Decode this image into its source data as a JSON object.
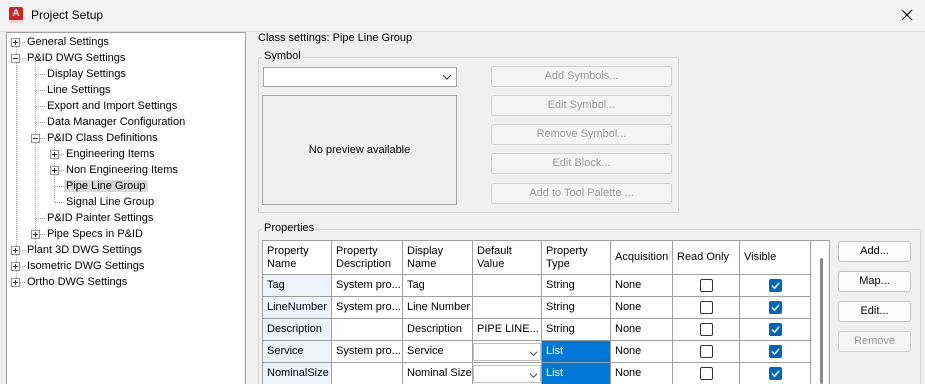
{
  "window": {
    "title": "Project Setup",
    "app_icon_letter": "A"
  },
  "tree": {
    "items": [
      {
        "label": "General Settings"
      },
      {
        "label": "P&ID DWG Settings"
      },
      {
        "label": "Display Settings"
      },
      {
        "label": "Line Settings"
      },
      {
        "label": "Export and Import Settings"
      },
      {
        "label": "Data Manager Configuration"
      },
      {
        "label": "P&ID Class Definitions"
      },
      {
        "label": "Engineering Items"
      },
      {
        "label": "Non Engineering Items"
      },
      {
        "label": "Pipe Line Group"
      },
      {
        "label": "Signal Line Group"
      },
      {
        "label": "P&ID Painter Settings"
      },
      {
        "label": "Pipe Specs in P&ID"
      },
      {
        "label": "Plant 3D DWG Settings"
      },
      {
        "label": "Isometric DWG Settings"
      },
      {
        "label": "Ortho DWG Settings"
      }
    ]
  },
  "class_settings": {
    "title": "Class settings: Pipe Line Group"
  },
  "symbol": {
    "group_label": "Symbol",
    "preview_text": "No preview available",
    "buttons": {
      "add": "Add Symbols...",
      "edit": "Edit Symbol...",
      "remove": "Remove Symbol...",
      "edit_block": "Edit Block...",
      "add_palette": "Add to Tool Palette ..."
    }
  },
  "properties": {
    "group_label": "Properties",
    "columns": {
      "c0": "Property\nName",
      "c1": "Property\nDescription",
      "c2": "Display\nName",
      "c3": "Default\nValue",
      "c4": "Property\nType",
      "c5": "Acquisition",
      "c6": "Read Only",
      "c7": "Visible"
    },
    "rows": [
      {
        "name": "Tag",
        "desc": "System pro...",
        "display": "Tag",
        "default": "",
        "type": "String",
        "acq": "None",
        "read_only": false,
        "visible": true
      },
      {
        "name": "LineNumber",
        "desc": "System pro...",
        "display": "Line Number",
        "default": "",
        "type": "String",
        "acq": "None",
        "read_only": false,
        "visible": true
      },
      {
        "name": "Description",
        "desc": "",
        "display": "Description",
        "default": "PIPE LINE...",
        "type": "String",
        "acq": "None",
        "read_only": false,
        "visible": true
      },
      {
        "name": "Service",
        "desc": "System pro...",
        "display": "Service",
        "default": "",
        "type": "List",
        "acq": "None",
        "read_only": false,
        "visible": true
      },
      {
        "name": "NominalSize",
        "desc": "",
        "display": "Nominal Size",
        "default": "",
        "type": "List",
        "acq": "None",
        "read_only": false,
        "visible": true
      }
    ],
    "buttons": {
      "add": "Add...",
      "map": "Map...",
      "edit": "Edit...",
      "remove": "Remove"
    }
  },
  "colors": {
    "selection": "#0078d7",
    "checkbox": "#0067c0",
    "app_icon": "#d42027"
  }
}
